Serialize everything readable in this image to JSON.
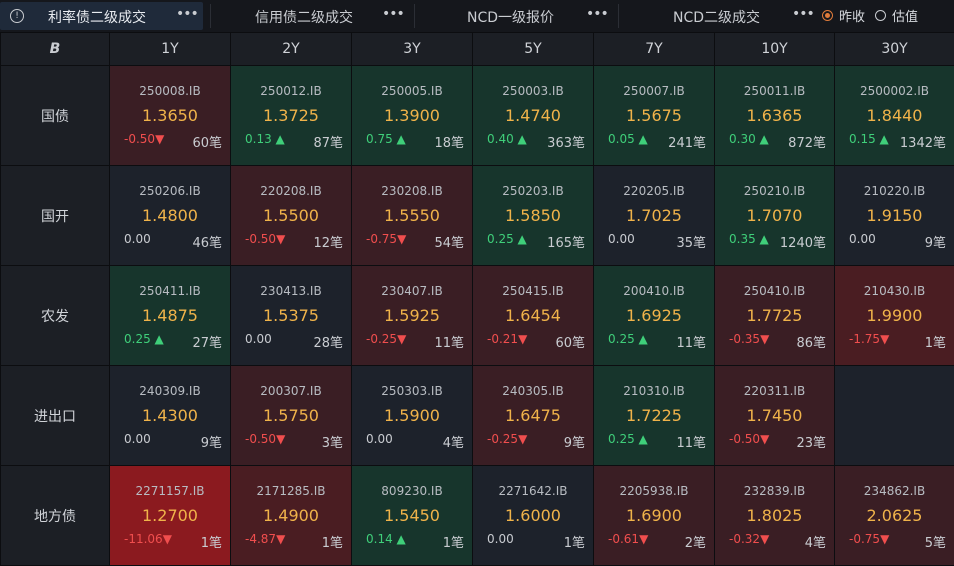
{
  "tabs": [
    {
      "label": "利率债二级成交",
      "active": true
    },
    {
      "label": "信用债二级成交",
      "active": false
    },
    {
      "label": "NCD一级报价",
      "active": false
    },
    {
      "label": "NCD二级成交",
      "active": false
    }
  ],
  "more_glyph": "•••",
  "info_glyph": "!",
  "radio": [
    {
      "label": "昨收",
      "checked": true
    },
    {
      "label": "估值",
      "checked": false
    }
  ],
  "corner_glyph": "B",
  "columns": [
    "1Y",
    "2Y",
    "3Y",
    "5Y",
    "7Y",
    "10Y",
    "30Y"
  ],
  "rows": [
    {
      "label": "国债",
      "cells": [
        {
          "code": "250008.IB",
          "yield": "1.3650",
          "chg": "-0.50",
          "dir": "down",
          "cnt": "60笔",
          "bg": "red"
        },
        {
          "code": "250012.IB",
          "yield": "1.3725",
          "chg": "0.13",
          "dir": "up",
          "cnt": "87笔",
          "bg": "green"
        },
        {
          "code": "250005.IB",
          "yield": "1.3900",
          "chg": "0.75",
          "dir": "up",
          "cnt": "18笔",
          "bg": "green"
        },
        {
          "code": "250003.IB",
          "yield": "1.4740",
          "chg": "0.40",
          "dir": "up",
          "cnt": "363笔",
          "bg": "green"
        },
        {
          "code": "250007.IB",
          "yield": "1.5675",
          "chg": "0.05",
          "dir": "up",
          "cnt": "241笔",
          "bg": "green"
        },
        {
          "code": "250011.IB",
          "yield": "1.6365",
          "chg": "0.30",
          "dir": "up",
          "cnt": "872笔",
          "bg": "green"
        },
        {
          "code": "2500002.IB",
          "yield": "1.8440",
          "chg": "0.15",
          "dir": "up",
          "cnt": "1342笔",
          "bg": "green"
        }
      ]
    },
    {
      "label": "国开",
      "cells": [
        {
          "code": "250206.IB",
          "yield": "1.4800",
          "chg": "0.00",
          "dir": "flat",
          "cnt": "46笔",
          "bg": "neutral"
        },
        {
          "code": "220208.IB",
          "yield": "1.5500",
          "chg": "-0.50",
          "dir": "down",
          "cnt": "12笔",
          "bg": "red"
        },
        {
          "code": "230208.IB",
          "yield": "1.5550",
          "chg": "-0.75",
          "dir": "down",
          "cnt": "54笔",
          "bg": "red"
        },
        {
          "code": "250203.IB",
          "yield": "1.5850",
          "chg": "0.25",
          "dir": "up",
          "cnt": "165笔",
          "bg": "green"
        },
        {
          "code": "220205.IB",
          "yield": "1.7025",
          "chg": "0.00",
          "dir": "flat",
          "cnt": "35笔",
          "bg": "neutral"
        },
        {
          "code": "250210.IB",
          "yield": "1.7070",
          "chg": "0.35",
          "dir": "up",
          "cnt": "1240笔",
          "bg": "green"
        },
        {
          "code": "210220.IB",
          "yield": "1.9150",
          "chg": "0.00",
          "dir": "flat",
          "cnt": "9笔",
          "bg": "neutral"
        }
      ]
    },
    {
      "label": "农发",
      "cells": [
        {
          "code": "250411.IB",
          "yield": "1.4875",
          "chg": "0.25",
          "dir": "up",
          "cnt": "27笔",
          "bg": "green"
        },
        {
          "code": "230413.IB",
          "yield": "1.5375",
          "chg": "0.00",
          "dir": "flat",
          "cnt": "28笔",
          "bg": "neutral"
        },
        {
          "code": "230407.IB",
          "yield": "1.5925",
          "chg": "-0.25",
          "dir": "down",
          "cnt": "11笔",
          "bg": "red"
        },
        {
          "code": "250415.IB",
          "yield": "1.6454",
          "chg": "-0.21",
          "dir": "down",
          "cnt": "60笔",
          "bg": "red"
        },
        {
          "code": "200410.IB",
          "yield": "1.6925",
          "chg": "0.25",
          "dir": "up",
          "cnt": "11笔",
          "bg": "green"
        },
        {
          "code": "250410.IB",
          "yield": "1.7725",
          "chg": "-0.35",
          "dir": "down",
          "cnt": "86笔",
          "bg": "red"
        },
        {
          "code": "210430.IB",
          "yield": "1.9900",
          "chg": "-1.75",
          "dir": "down",
          "cnt": "1笔",
          "bg": "red2"
        }
      ]
    },
    {
      "label": "进出口",
      "cells": [
        {
          "code": "240309.IB",
          "yield": "1.4300",
          "chg": "0.00",
          "dir": "flat",
          "cnt": "9笔",
          "bg": "neutral"
        },
        {
          "code": "200307.IB",
          "yield": "1.5750",
          "chg": "-0.50",
          "dir": "down",
          "cnt": "3笔",
          "bg": "red"
        },
        {
          "code": "250303.IB",
          "yield": "1.5900",
          "chg": "0.00",
          "dir": "flat",
          "cnt": "4笔",
          "bg": "neutral"
        },
        {
          "code": "240305.IB",
          "yield": "1.6475",
          "chg": "-0.25",
          "dir": "down",
          "cnt": "9笔",
          "bg": "red"
        },
        {
          "code": "210310.IB",
          "yield": "1.7225",
          "chg": "0.25",
          "dir": "up",
          "cnt": "11笔",
          "bg": "green"
        },
        {
          "code": "220311.IB",
          "yield": "1.7450",
          "chg": "-0.50",
          "dir": "down",
          "cnt": "23笔",
          "bg": "red"
        },
        null
      ]
    },
    {
      "label": "地方债",
      "cells": [
        {
          "code": "2271157.IB",
          "yield": "1.2700",
          "chg": "-11.06",
          "dir": "down",
          "cnt": "1笔",
          "bg": "red3"
        },
        {
          "code": "2171285.IB",
          "yield": "1.4900",
          "chg": "-4.87",
          "dir": "down",
          "cnt": "1笔",
          "bg": "red2"
        },
        {
          "code": "809230.IB",
          "yield": "1.5450",
          "chg": "0.14",
          "dir": "up",
          "cnt": "1笔",
          "bg": "green"
        },
        {
          "code": "2271642.IB",
          "yield": "1.6000",
          "chg": "0.00",
          "dir": "flat",
          "cnt": "1笔",
          "bg": "neutral"
        },
        {
          "code": "2205938.IB",
          "yield": "1.6900",
          "chg": "-0.61",
          "dir": "down",
          "cnt": "2笔",
          "bg": "red"
        },
        {
          "code": "232839.IB",
          "yield": "1.8025",
          "chg": "-0.32",
          "dir": "down",
          "cnt": "4笔",
          "bg": "red"
        },
        {
          "code": "234862.IB",
          "yield": "2.0625",
          "chg": "-0.75",
          "dir": "down",
          "cnt": "5笔",
          "bg": "red"
        }
      ]
    }
  ],
  "colors": {
    "yield": "#f0b34a",
    "up": "#3fcf7a",
    "down": "#f04e4e",
    "accent": "#e07b3a"
  }
}
